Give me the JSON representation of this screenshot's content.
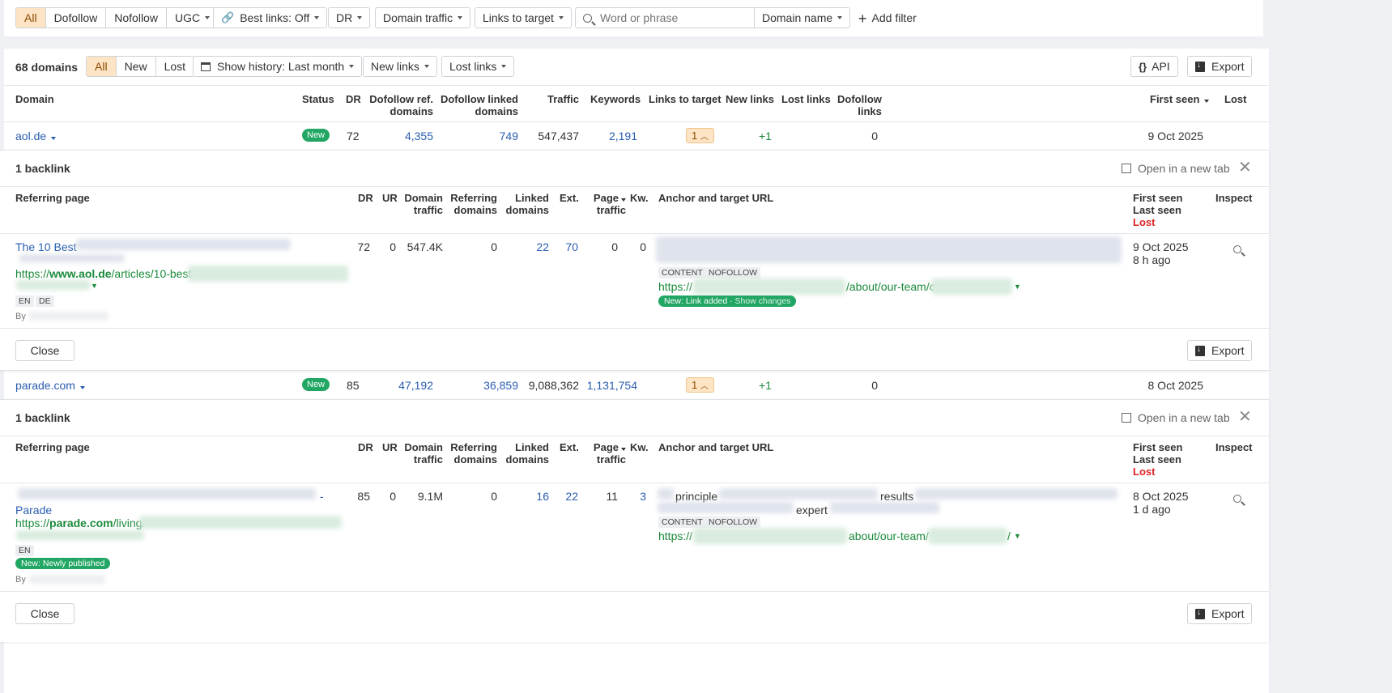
{
  "filters": {
    "link_types": [
      "All",
      "Dofollow",
      "Nofollow",
      "UGC"
    ],
    "best_links": "Best links: Off",
    "dr": "DR",
    "domain_traffic": "Domain traffic",
    "links_to_target": "Links to target",
    "search_placeholder": "Word or phrase",
    "domain_name": "Domain name",
    "add_filter": "Add filter"
  },
  "toolbar": {
    "count": "68 domains",
    "status_tabs": [
      "All",
      "New",
      "Lost"
    ],
    "history": "Show history: Last month",
    "new_links": "New links",
    "lost_links": "Lost links",
    "api": "API",
    "export": "Export"
  },
  "columns": {
    "domain": "Domain",
    "status": "Status",
    "dr": "DR",
    "dofollow_ref_1": "Dofollow ref.",
    "dofollow_ref_2": "domains",
    "dofollow_linked_1": "Dofollow linked",
    "dofollow_linked_2": "domains",
    "traffic": "Traffic",
    "keywords": "Keywords",
    "links_to_target": "Links to target",
    "new_links": "New links",
    "lost_links": "Lost links",
    "dofollow_links_1": "Dofollow",
    "dofollow_links_2": "links",
    "first_seen": "First seen",
    "lost": "Lost"
  },
  "rows": [
    {
      "domain": "aol.de",
      "status": "New",
      "dr": "72",
      "dofollow_ref": "4,355",
      "dofollow_linked": "749",
      "traffic": "547,437",
      "keywords": "2,191",
      "links_to_target": "1",
      "new_links": "+1",
      "dofollow_links": "0",
      "first_seen": "9 Oct 2025"
    },
    {
      "domain": "parade.com",
      "status": "New",
      "dr": "85",
      "dofollow_ref": "47,192",
      "dofollow_linked": "36,859",
      "traffic": "9,088,362",
      "keywords": "1,131,754",
      "links_to_target": "1",
      "new_links": "+1",
      "dofollow_links": "0",
      "first_seen": "8 Oct 2025"
    }
  ],
  "sub": {
    "title": "1 backlink",
    "open_tab": "Open in a new tab",
    "close": "Close",
    "export": "Export",
    "cols": {
      "referring_page": "Referring page",
      "dr": "DR",
      "ur": "UR",
      "domain_traffic_1": "Domain",
      "domain_traffic_2": "traffic",
      "referring_domains_1": "Referring",
      "referring_domains_2": "domains",
      "linked_domains_1": "Linked",
      "linked_domains_2": "domains",
      "ext": "Ext.",
      "page_traffic_1": "Page",
      "page_traffic_2": "traffic",
      "kw": "Kw.",
      "anchor": "Anchor and target URL",
      "first_seen": "First seen",
      "last_seen": "Last seen",
      "lost": "Lost",
      "inspect": "Inspect"
    }
  },
  "backlinks": [
    {
      "title": "The 10 Best",
      "url_prefix": "https://",
      "url_domain": "www.aol.de",
      "url_path": "/articles/10-best-",
      "langs": [
        "EN",
        "DE"
      ],
      "by": "By",
      "dr": "72",
      "ur": "0",
      "domain_traffic": "547.4K",
      "ref_domains": "0",
      "linked_domains": "22",
      "ext": "70",
      "page_traffic": "0",
      "kw": "0",
      "tags": [
        "CONTENT",
        "NOFOLLOW"
      ],
      "target_prefix": "https://",
      "target_mid": "/about/our-team/",
      "target_end": "c",
      "new_tag": "New: Link added",
      "show_changes": "· Show changes",
      "first_seen": "9 Oct 2025",
      "last_seen": "8 h ago"
    },
    {
      "title_dash": "-",
      "title_end": "Parade",
      "url_prefix": "https://",
      "url_domain": "parade.com",
      "url_path": "/living/",
      "langs": [
        "EN"
      ],
      "new_tag": "New: Newly published",
      "by": "By",
      "dr": "85",
      "ur": "0",
      "domain_traffic": "9.1M",
      "ref_domains": "0",
      "linked_domains": "16",
      "ext": "22",
      "page_traffic": "11",
      "kw": "3",
      "anchor_1": "principle",
      "anchor_2": "results",
      "anchor_3": "expert",
      "tags": [
        "CONTENT",
        "NOFOLLOW"
      ],
      "target_prefix": "https://",
      "target_mid": "about/our-team/",
      "target_end": "/",
      "first_seen": "8 Oct 2025",
      "last_seen": "1 d ago"
    }
  ]
}
